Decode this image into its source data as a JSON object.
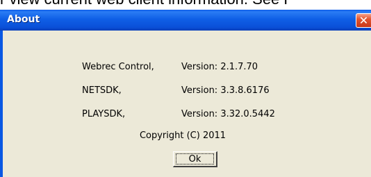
{
  "background": {
    "partial_text": "r view current web client information. See F"
  },
  "dialog": {
    "title": "About",
    "close_glyph": "✕",
    "components": [
      {
        "name": "Webrec Control,",
        "version": "Version: 2.1.7.70"
      },
      {
        "name": "NETSDK,",
        "version": "Version: 3.3.8.6176"
      },
      {
        "name": "PLAYSDK,",
        "version": "Version: 3.32.0.5442"
      }
    ],
    "copyright": "Copyright (C) 2011",
    "ok_label": "Ok"
  },
  "colors": {
    "titlebar": "#0a58e3",
    "client_bg": "#ece9d8",
    "close_button": "#e2552f"
  }
}
